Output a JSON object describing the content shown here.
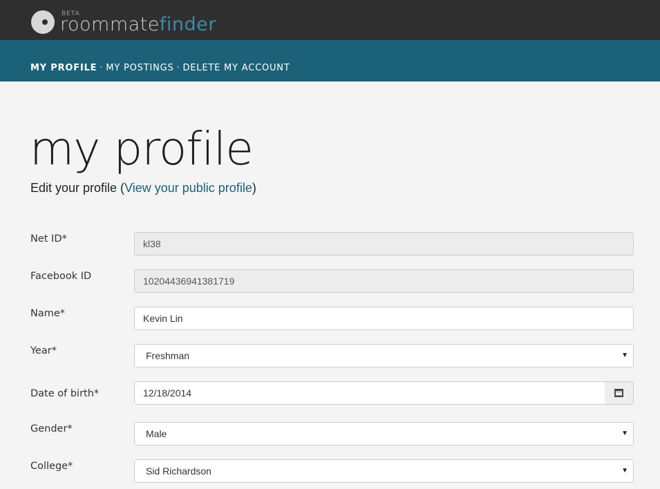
{
  "brand": {
    "beta": "BETA",
    "name_part1": "roommate",
    "name_part2": "finder"
  },
  "nav": {
    "items": [
      "MY PROFILE",
      "MY POSTINGS",
      "DELETE MY ACCOUNT"
    ],
    "separator": "·"
  },
  "page": {
    "title": "my profile",
    "subtitle_prefix": "Edit your profile (",
    "subtitle_link": "View your public profile",
    "subtitle_suffix": ")"
  },
  "form": {
    "netid": {
      "label": "Net ID*",
      "value": "kl38"
    },
    "facebook": {
      "label": "Facebook ID",
      "value": "10204436941381719"
    },
    "name": {
      "label": "Name*",
      "value": "Kevin Lin"
    },
    "year": {
      "label": "Year*",
      "value": "Freshman"
    },
    "dob": {
      "label": "Date of birth*",
      "value": "12/18/2014"
    },
    "gender": {
      "label": "Gender*",
      "value": "Male"
    },
    "college": {
      "label": "College*",
      "value": "Sid Richardson"
    }
  },
  "colors": {
    "topbar": "#2f2f2f",
    "navbar": "#1b6279",
    "accent": "#3d8aa5",
    "link": "#1b6279",
    "background": "#f4f4f4"
  },
  "icons": {
    "logo": "logo-icon",
    "calendar": "calendar-icon",
    "dropdown": "caret-down-icon"
  }
}
